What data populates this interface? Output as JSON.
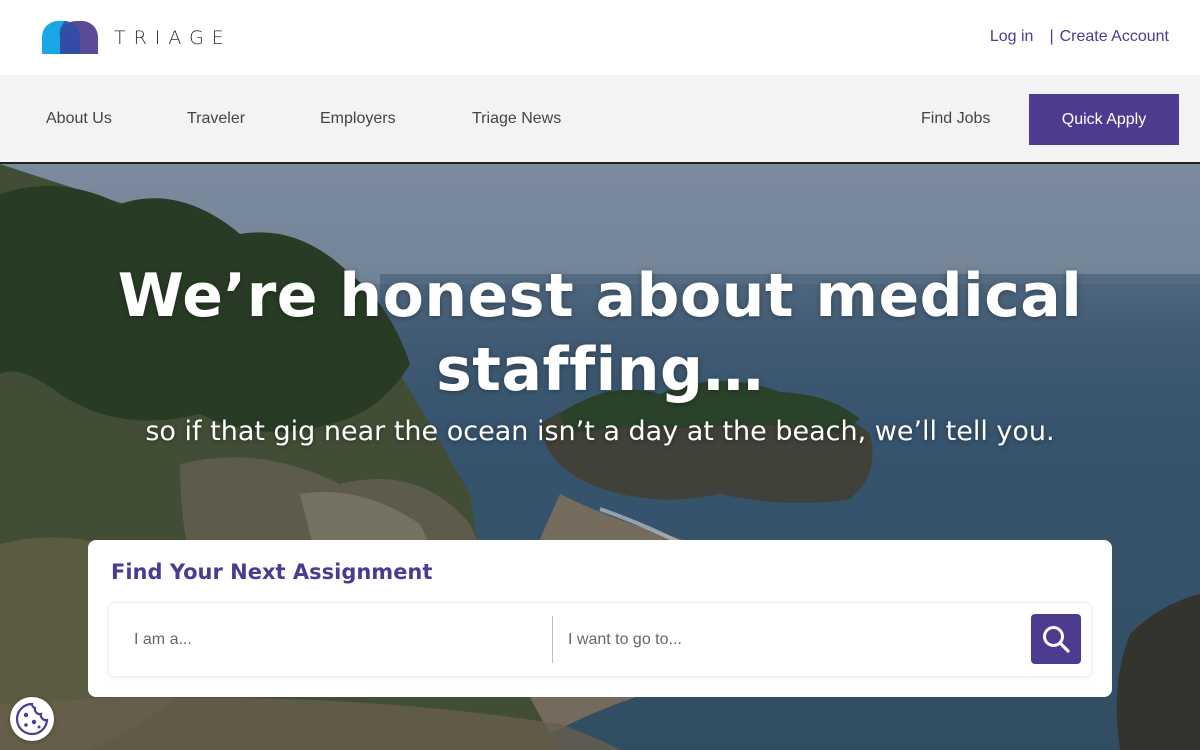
{
  "brand": {
    "name": "TRIAGE",
    "primary_color": "#4d3b8f",
    "logo_blue": "#1aa7e6",
    "logo_purple": "#4d3b8f"
  },
  "auth": {
    "login_label": "Log in",
    "separator": "|",
    "create_account_label": "Create Account"
  },
  "nav": {
    "items": [
      {
        "label": "About Us"
      },
      {
        "label": "Traveler"
      },
      {
        "label": "Employers"
      },
      {
        "label": "Triage News"
      }
    ],
    "find_jobs_label": "Find Jobs",
    "quick_apply_label": "Quick Apply"
  },
  "hero": {
    "headline": "We’re honest about medical staffing…",
    "subline": "so if that gig near the ocean isn’t a day at the beach, we’ll tell you."
  },
  "search": {
    "title": "Find Your Next Assignment",
    "role_placeholder": "I am a...",
    "location_placeholder": "I want to go to...",
    "search_icon": "search-icon"
  },
  "cookie": {
    "icon": "cookie-icon"
  }
}
